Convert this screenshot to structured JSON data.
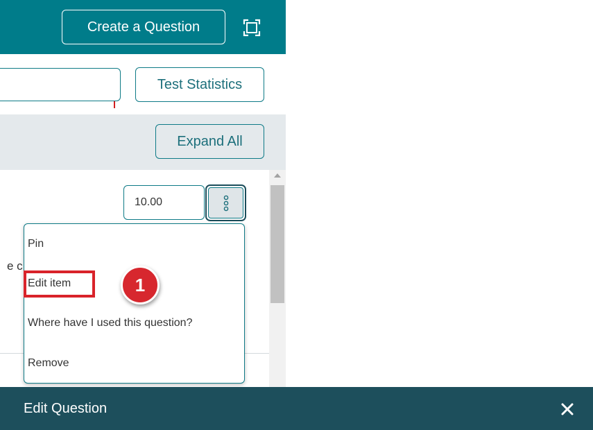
{
  "header": {
    "create_label": "Create a Question",
    "icon": "fullscreen-icon"
  },
  "toolbar": {
    "search_value": "",
    "test_stats_label": "Test Statistics"
  },
  "controls": {
    "expand_label": "Expand All"
  },
  "question": {
    "points_value": "10.00",
    "clipped_text": "e c",
    "more_icon": "kebab-icon"
  },
  "menu": {
    "items": [
      {
        "label": "Pin"
      },
      {
        "label": "Edit item"
      },
      {
        "label": "Where have I used this question?"
      },
      {
        "label": "Remove"
      }
    ]
  },
  "annotation": {
    "step": "1",
    "highlight_color": "#d9232a"
  },
  "bottom_bar": {
    "title": "Edit Question",
    "close_icon": "close-icon"
  },
  "colors": {
    "header_teal": "#007c8a",
    "bottom_bar": "#1d4f5c",
    "accent": "#0d7a86"
  }
}
